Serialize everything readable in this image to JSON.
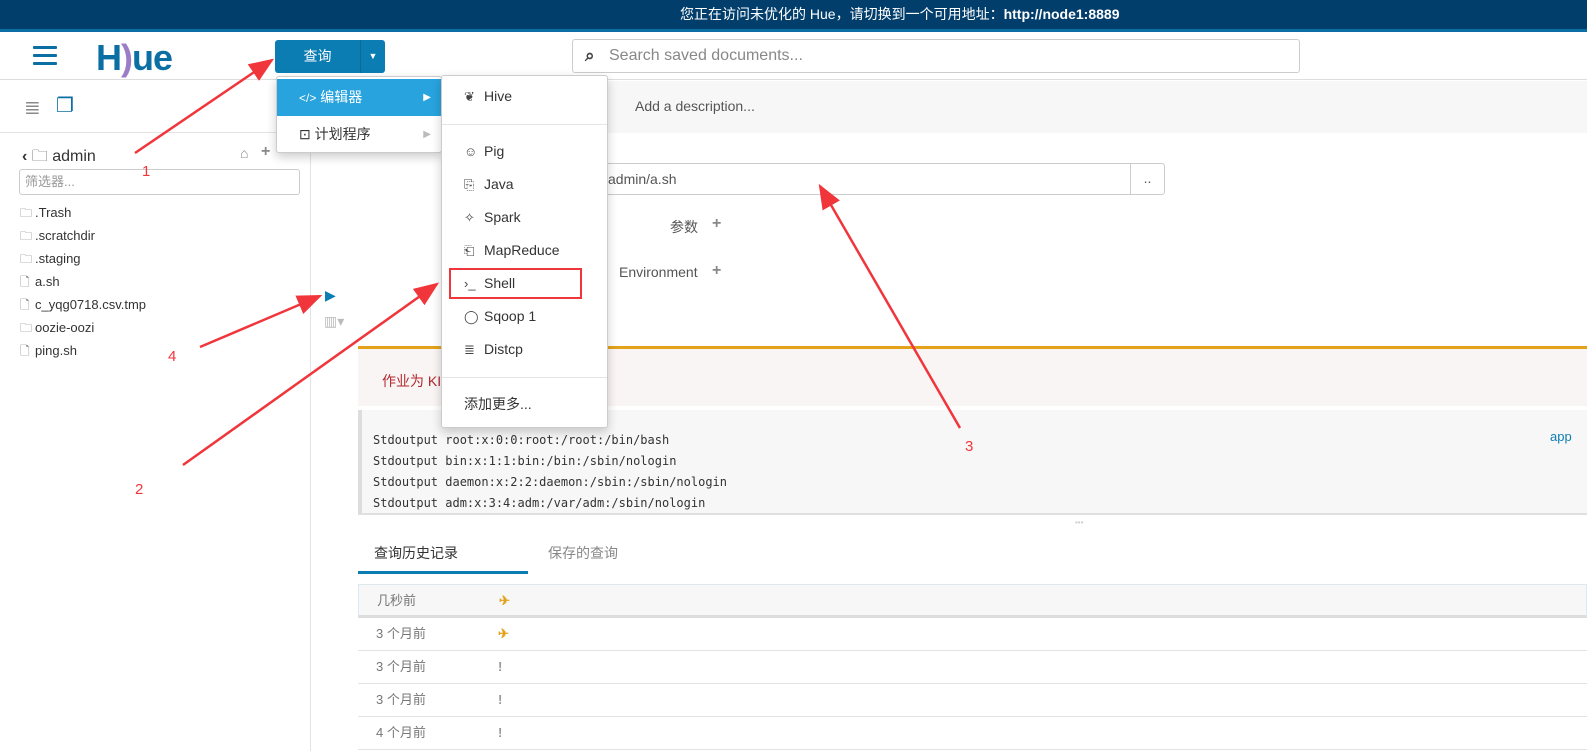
{
  "banner": {
    "text": "您正在访问未优化的 Hue，请切换到一个可用地址：",
    "url": "http://node1:8889"
  },
  "header": {
    "logo": "HUE",
    "query_button": "查询",
    "search_placeholder": "Search saved documents..."
  },
  "sidebar": {
    "folder": "admin",
    "filter_placeholder": "筛选器...",
    "files": [
      {
        "name": ".Trash",
        "type": "folder"
      },
      {
        "name": ".scratchdir",
        "type": "folder"
      },
      {
        "name": ".staging",
        "type": "folder"
      },
      {
        "name": "a.sh",
        "type": "file"
      },
      {
        "name": "c_yqg0718.csv.tmp",
        "type": "file"
      },
      {
        "name": "oozie-oozi",
        "type": "folder"
      },
      {
        "name": "ping.sh",
        "type": "file"
      }
    ]
  },
  "editor": {
    "description_placeholder": "Add a description...",
    "path": "/user/admin/a.sh",
    "path_visible": "admin/a.sh",
    "browse": "..",
    "params_label": "参数",
    "env_label": "Environment"
  },
  "alert": {
    "text": "作业为 KI"
  },
  "log": {
    "lines": [
      "Stdoutput root:x:0:0:root:/root:/bin/bash",
      "Stdoutput bin:x:1:1:bin:/bin:/sbin/nologin",
      "Stdoutput daemon:x:2:2:daemon:/sbin:/sbin/nologin",
      "Stdoutput adm:x:3:4:adm:/var/adm:/sbin/nologin"
    ],
    "side_link": "app"
  },
  "tabs": [
    {
      "label": "查询历史记录",
      "active": true
    },
    {
      "label": "保存的查询",
      "active": false
    }
  ],
  "history": [
    {
      "time": "几秒前",
      "status": "running"
    },
    {
      "time": "3 个月前",
      "status": "running"
    },
    {
      "time": "3 个月前",
      "status": "failed"
    },
    {
      "time": "3 个月前",
      "status": "failed"
    },
    {
      "time": "4 个月前",
      "status": "failed"
    }
  ],
  "menu": {
    "items": [
      {
        "label": "编辑器",
        "icon": "code-icon",
        "active": true
      },
      {
        "label": "计划程序",
        "icon": "schedule-icon",
        "active": false
      }
    ],
    "submenu": [
      {
        "label": "Hive",
        "icon": "hive-icon"
      },
      {
        "label": "Pig",
        "icon": "pig-icon"
      },
      {
        "label": "Java",
        "icon": "java-icon"
      },
      {
        "label": "Spark",
        "icon": "spark-icon"
      },
      {
        "label": "MapReduce",
        "icon": "mapreduce-icon"
      },
      {
        "label": "Shell",
        "icon": "terminal-icon"
      },
      {
        "label": "Sqoop 1",
        "icon": "sqoop-icon"
      },
      {
        "label": "Distcp",
        "icon": "database-icon"
      }
    ],
    "add_more": "添加更多..."
  },
  "annotations": [
    "1",
    "2",
    "3",
    "4"
  ],
  "colors": {
    "banner": "#023e6b",
    "accent": "#0b7db3",
    "menu_active": "#29a3de",
    "warning": "#e3a21a",
    "annotation": "#f0353b"
  }
}
